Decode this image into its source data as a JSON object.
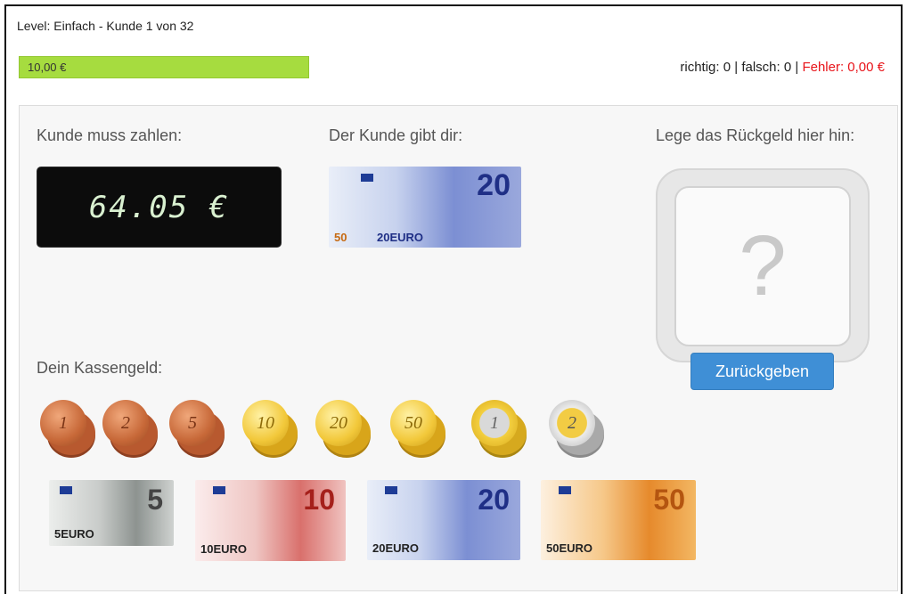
{
  "header": {
    "level_text": "Level: Einfach - Kunde 1 von 32",
    "progress": {
      "label": "10,00 €",
      "fraction": 1.0,
      "color": "#a6dc3f"
    },
    "score": {
      "richtig_text": "richtig: 0",
      "sep1": " | ",
      "falsch_text": "falsch: 0",
      "sep2": " | ",
      "fehler_text": "Fehler: 0,00 €",
      "fehler_color": "#e8141a"
    }
  },
  "main": {
    "pay_heading": "Kunde muss zahlen:",
    "amount_display": "64.05 €",
    "given_heading": "Der Kunde gibt dir:",
    "given_note": {
      "value": "20",
      "left_small": "50",
      "right_small": "20EURO",
      "icon": "banknote-20-icon"
    },
    "change_heading": "Lege das Rückgeld hier hin:",
    "drop_placeholder": "?",
    "return_button": "Zurückgeben",
    "cash_heading": "Dein Kassengeld:",
    "coins": [
      {
        "label": "1",
        "type": "copper",
        "icon": "coin-1-cent-icon"
      },
      {
        "label": "2",
        "type": "copper",
        "icon": "coin-2-cent-icon"
      },
      {
        "label": "5",
        "type": "copper",
        "icon": "coin-5-cent-icon"
      },
      {
        "label": "10",
        "type": "gold",
        "icon": "coin-10-cent-icon"
      },
      {
        "label": "20",
        "type": "gold",
        "icon": "coin-20-cent-icon"
      },
      {
        "label": "50",
        "type": "gold",
        "icon": "coin-50-cent-icon"
      },
      {
        "label": "1",
        "type": "bimetal1",
        "icon": "coin-1-euro-icon"
      },
      {
        "label": "2",
        "type": "bimetal2",
        "icon": "coin-2-euro-icon"
      }
    ],
    "notes": [
      {
        "value": "5",
        "small": "5EURO",
        "icon": "banknote-5-icon"
      },
      {
        "value": "10",
        "small": "10EURO",
        "icon": "banknote-10-icon"
      },
      {
        "value": "20",
        "small": "20EURO",
        "icon": "banknote-20-icon"
      },
      {
        "value": "50",
        "small": "50EURO",
        "icon": "banknote-50-icon"
      }
    ]
  }
}
